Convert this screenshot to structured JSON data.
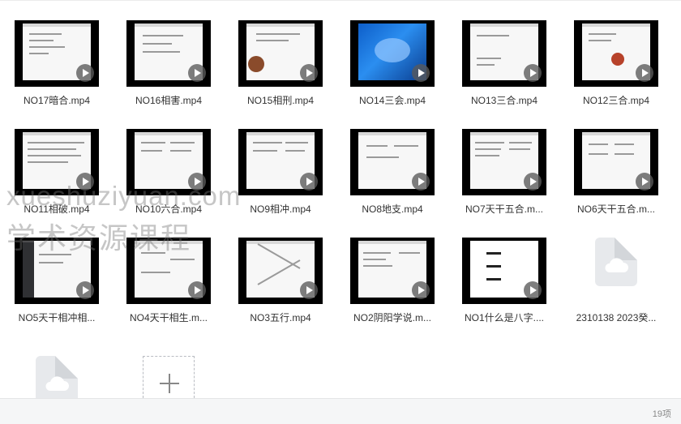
{
  "files": [
    {
      "name": "NO17暗合.mp4"
    },
    {
      "name": "NO16相害.mp4"
    },
    {
      "name": "NO15相刑.mp4"
    },
    {
      "name": "NO14三会.mp4"
    },
    {
      "name": "NO13三合.mp4"
    },
    {
      "name": "NO12三合.mp4"
    },
    {
      "name": "NO11相破.mp4"
    },
    {
      "name": "NO10六合.mp4"
    },
    {
      "name": "NO9相冲.mp4"
    },
    {
      "name": "NO8地支.mp4"
    },
    {
      "name": "NO7天干五合.m..."
    },
    {
      "name": "NO6天干五合.m..."
    },
    {
      "name": "NO5天干相冲相..."
    },
    {
      "name": "NO4天干相生.m..."
    },
    {
      "name": "NO3五行.mp4"
    },
    {
      "name": "NO2阴阳学说.m..."
    },
    {
      "name": "NO1什么是八字...."
    },
    {
      "name": "2310138 2023癸..."
    }
  ],
  "footer": {
    "count_label": "19项"
  },
  "watermark": {
    "line1": "xueshuziyuan.com",
    "line2": "学术资源课程"
  },
  "colors": {
    "thumb_bg": "#000000",
    "cloud": "#ffffff",
    "file_bg": "#e7e9ec"
  }
}
